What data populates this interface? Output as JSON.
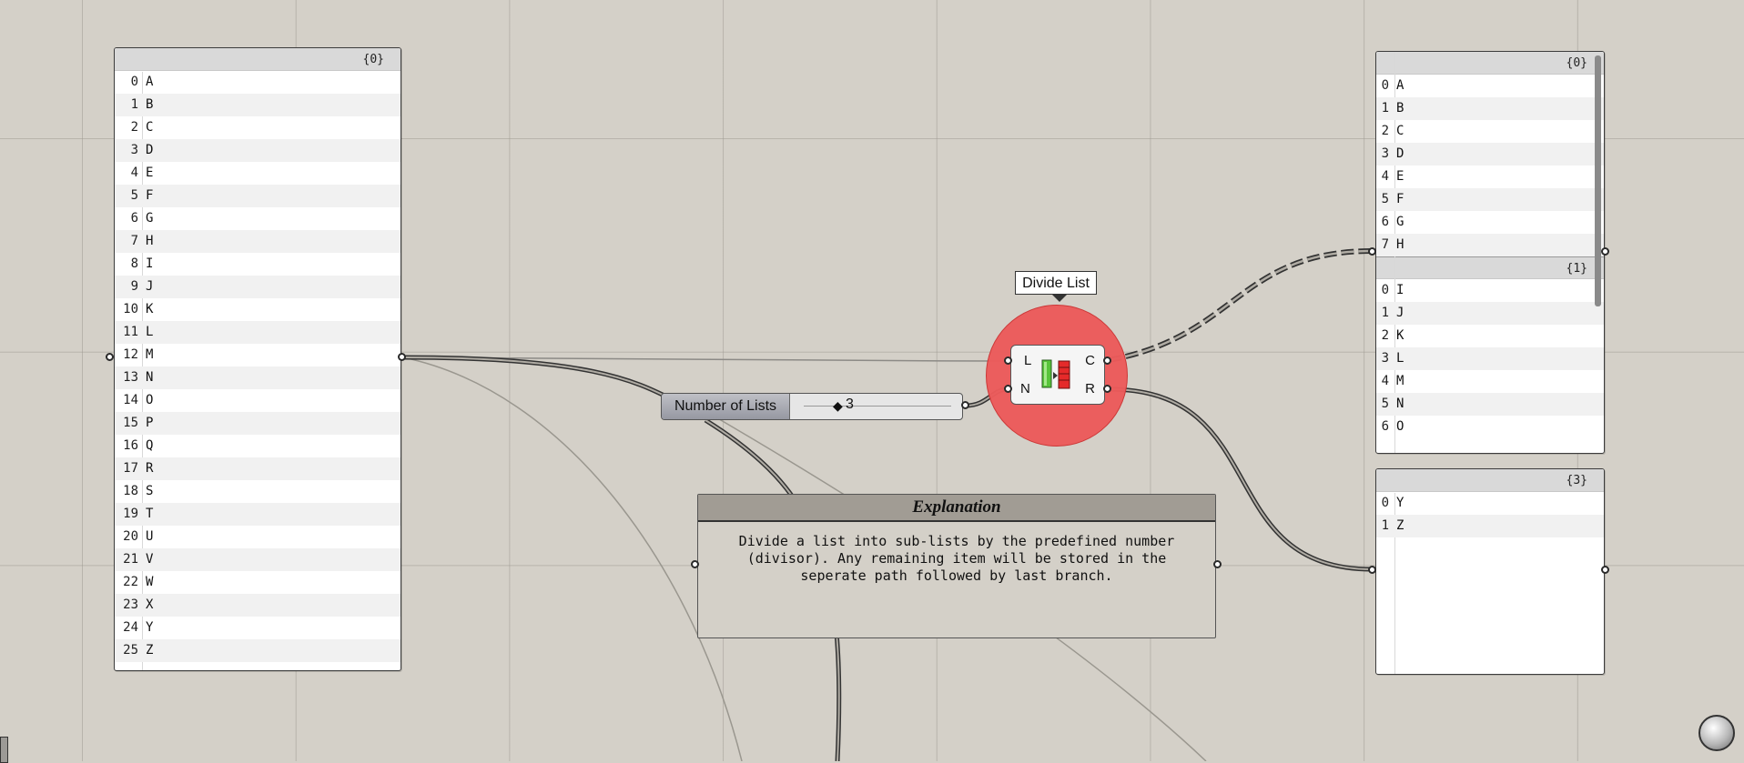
{
  "canvas": {
    "background": "#d4d0c8",
    "accent_halo": "#ec5b5b"
  },
  "left_panel": {
    "path": "{0}",
    "items": [
      "A",
      "B",
      "C",
      "D",
      "E",
      "F",
      "G",
      "H",
      "I",
      "J",
      "K",
      "L",
      "M",
      "N",
      "O",
      "P",
      "Q",
      "R",
      "S",
      "T",
      "U",
      "V",
      "W",
      "X",
      "Y",
      "Z"
    ]
  },
  "slider": {
    "label": "Number of Lists",
    "value": "3"
  },
  "component": {
    "tooltip": "Divide List",
    "inputs": [
      "L",
      "N"
    ],
    "outputs": [
      "C",
      "R"
    ],
    "icon": "divide-list-icon"
  },
  "scribble": {
    "title": "Explanation",
    "lines": [
      "Divide a list into sub-lists by the predefined number",
      "(divisor). Any remaining item will be stored in the",
      "seperate path followed by last branch."
    ]
  },
  "c_panel": {
    "branches": [
      {
        "path": "{0}",
        "items": [
          "A",
          "B",
          "C",
          "D",
          "E",
          "F",
          "G",
          "H"
        ]
      },
      {
        "path": "{1}",
        "items": [
          "I",
          "J",
          "K",
          "L",
          "M",
          "N",
          "O"
        ]
      }
    ]
  },
  "r_panel": {
    "path": "{3}",
    "items": [
      "Y",
      "Z"
    ]
  }
}
